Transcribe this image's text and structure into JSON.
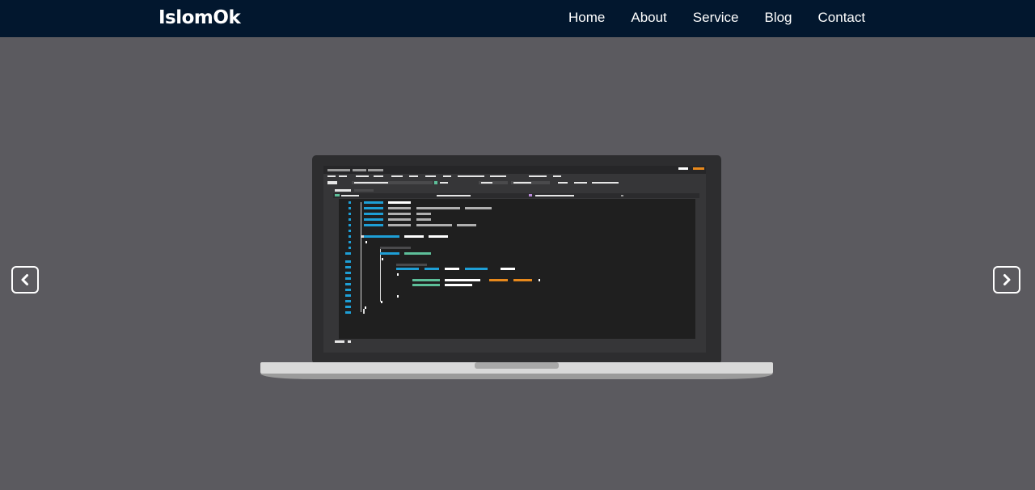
{
  "navbar": {
    "brand": "IslomOk",
    "links": [
      "Home",
      "About",
      "Service",
      "Blog",
      "Contact"
    ]
  },
  "hero": {
    "image_icon": "laptop-code-illustration",
    "prev_icon": "chevron-left-icon",
    "next_icon": "chevron-right-icon"
  },
  "colors": {
    "navbar_bg": "#02172e",
    "hero_bg": "#5b5a5f",
    "text": "#ffffff",
    "code_blue": "#1e9fd6",
    "code_green": "#5dbf99",
    "code_orange": "#e8891c"
  }
}
